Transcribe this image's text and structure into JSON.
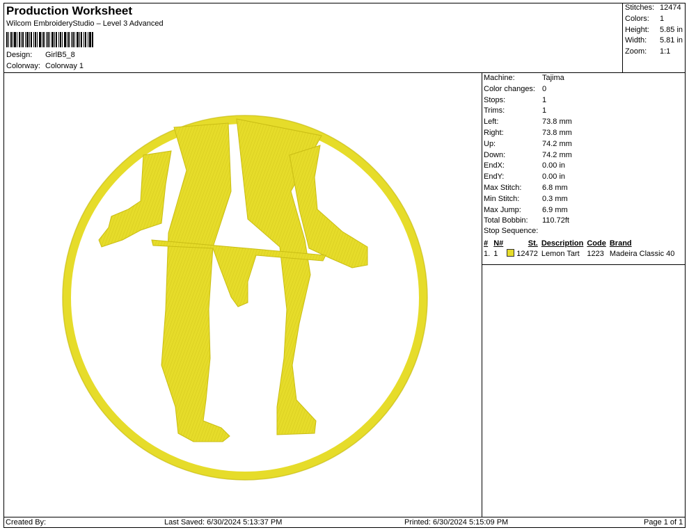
{
  "header": {
    "title": "Production Worksheet",
    "software": "Wilcom EmbroideryStudio – Level 3 Advanced",
    "design_label": "Design:",
    "design_value": "GirlB5_8",
    "colorway_label": "Colorway:",
    "colorway_value": "Colorway 1"
  },
  "summary": [
    {
      "label": "Stitches:",
      "value": "12474"
    },
    {
      "label": "Colors:",
      "value": "1"
    },
    {
      "label": "Height:",
      "value": "5.85 in"
    },
    {
      "label": "Width:",
      "value": "5.81 in"
    },
    {
      "label": "Zoom:",
      "value": "1:1"
    }
  ],
  "details": [
    {
      "label": "Machine:",
      "value": "Tajima"
    },
    {
      "label": "Color changes:",
      "value": "0"
    },
    {
      "label": "Stops:",
      "value": "1"
    },
    {
      "label": "Trims:",
      "value": "1"
    },
    {
      "label": "Left:",
      "value": "73.8 mm"
    },
    {
      "label": "Right:",
      "value": "73.8 mm"
    },
    {
      "label": "Up:",
      "value": "74.2 mm"
    },
    {
      "label": "Down:",
      "value": "74.2 mm"
    },
    {
      "label": "EndX:",
      "value": "0.00 in"
    },
    {
      "label": "EndY:",
      "value": "0.00 in"
    },
    {
      "label": "Max Stitch:",
      "value": "6.8 mm"
    },
    {
      "label": "Min Stitch:",
      "value": "0.3 mm"
    },
    {
      "label": "Max Jump:",
      "value": "6.9 mm"
    },
    {
      "label": "Total Bobbin:",
      "value": "110.72ft"
    }
  ],
  "stop_sequence": {
    "title": "Stop Sequence:",
    "headers": [
      "#",
      "N#",
      "St.",
      "Description",
      "Code",
      "Brand"
    ],
    "rows": [
      {
        "num": "1.",
        "needle": "1",
        "stitches": "12472",
        "description": "Lemon Tart",
        "code": "1223",
        "brand": "Madeira Classic 40",
        "color": "#e6dc2a"
      }
    ]
  },
  "design": {
    "thread_color": "#e6dc2a",
    "shade_color": "#c9bd14",
    "icon": "embroidered-legs-circle-icon"
  },
  "footer": {
    "created_by": "Created By:",
    "last_saved": "Last Saved: 6/30/2024 5:13:37 PM",
    "printed": "Printed: 6/30/2024 5:15:09 PM",
    "page": "Page 1 of 1"
  }
}
